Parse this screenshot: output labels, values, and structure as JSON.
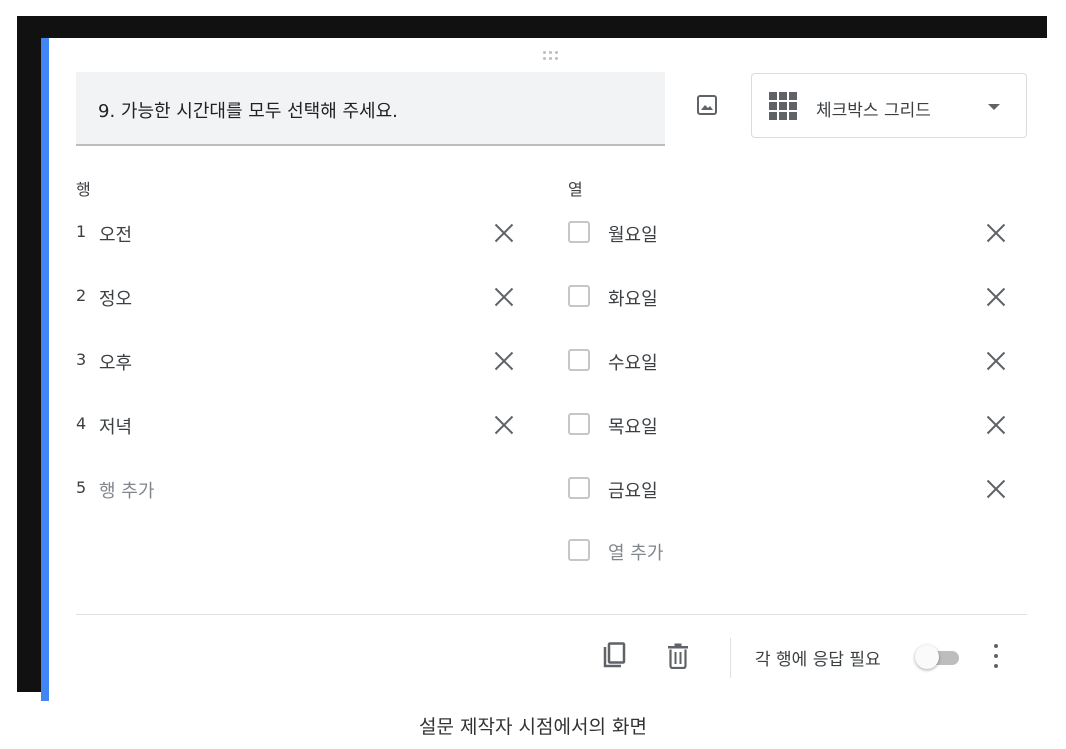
{
  "question": {
    "title": "9. 가능한 시간대를 모두 선택해 주세요.",
    "type_label": "체크박스 그리드"
  },
  "rows": {
    "header": "행",
    "items": [
      {
        "num": "1",
        "label": "오전"
      },
      {
        "num": "2",
        "label": "정오"
      },
      {
        "num": "3",
        "label": "오후"
      },
      {
        "num": "4",
        "label": "저녁"
      }
    ],
    "add": {
      "num": "5",
      "label": "행 추가"
    }
  },
  "columns": {
    "header": "열",
    "items": [
      {
        "label": "월요일"
      },
      {
        "label": "화요일"
      },
      {
        "label": "수요일"
      },
      {
        "label": "목요일"
      },
      {
        "label": "금요일"
      }
    ],
    "add_label": "열 추가"
  },
  "footer": {
    "required_label": "각 행에 응답 필요",
    "required_on": false
  },
  "caption": "설문 제작자 시점에서의 화면",
  "colors": {
    "accent": "#4285f4",
    "frame": "#111111"
  }
}
